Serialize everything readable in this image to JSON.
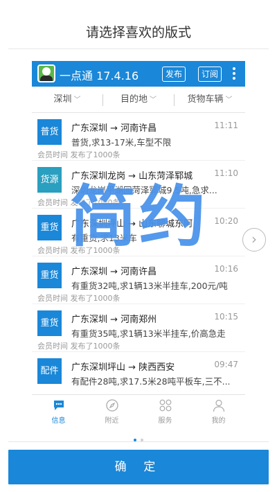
{
  "page": {
    "title": "请选择喜欢的版式",
    "overlay_text": "简约",
    "confirm_label": "确 定",
    "carousel": {
      "pages": 2,
      "current": 1
    }
  },
  "app": {
    "title": "一点通 17.4.16",
    "publish_label": "发布",
    "subscribe_label": "订阅",
    "accent_color": "#1a87d8"
  },
  "filters": [
    {
      "label": "深圳"
    },
    {
      "label": "目的地"
    },
    {
      "label": "货物车辆"
    }
  ],
  "items": [
    {
      "badge": "普货",
      "badge_color": "#1a87d8",
      "route": "广东深圳 → 河南许昌",
      "time": "11:11",
      "desc": "普货,求13-17米,车型不限",
      "meta": "会员时间 发布了1000条"
    },
    {
      "badge": "货源",
      "badge_color": "#2a9fbf",
      "route": "广东深圳龙岗 → 山东菏泽郓城",
      "time": "11:10",
      "desc": "深圳龙岗平湖回菏泽郓城9.5吨,急求...",
      "meta": "会员时间 发布了1000条"
    },
    {
      "badge": "重货",
      "badge_color": "#1a87d8",
      "route": "广东深圳坪山 → 山东聊城东阿",
      "time": "10:20",
      "desc": "有重货,求13米车",
      "meta": "会员时间 发布了1000条"
    },
    {
      "badge": "重货",
      "badge_color": "#1a87d8",
      "route": "广东深圳 → 河南许昌",
      "time": "10:16",
      "desc": "有重货32吨,求1辆13米半挂车,200元/吨",
      "meta": "会员时间 发布了1000条"
    },
    {
      "badge": "重货",
      "badge_color": "#1a87d8",
      "route": "广东深圳 → 河南郑州",
      "time": "10:15",
      "desc": "有重货35吨,求1辆13米半挂车,价高急走",
      "meta": "会员时间 发布了1000条"
    },
    {
      "badge": "配件",
      "badge_color": "#1a87d8",
      "route": "广东深圳坪山 → 陕西西安",
      "time": "09:47",
      "desc": "有配件28吨,求17.5米28吨平板车,三不...",
      "meta": ""
    }
  ],
  "nav": [
    {
      "label": "信息",
      "icon": "chat-icon",
      "active": true
    },
    {
      "label": "附近",
      "icon": "compass-icon",
      "active": false
    },
    {
      "label": "服务",
      "icon": "grid-icon",
      "active": false
    },
    {
      "label": "我的",
      "icon": "person-icon",
      "active": false
    }
  ]
}
